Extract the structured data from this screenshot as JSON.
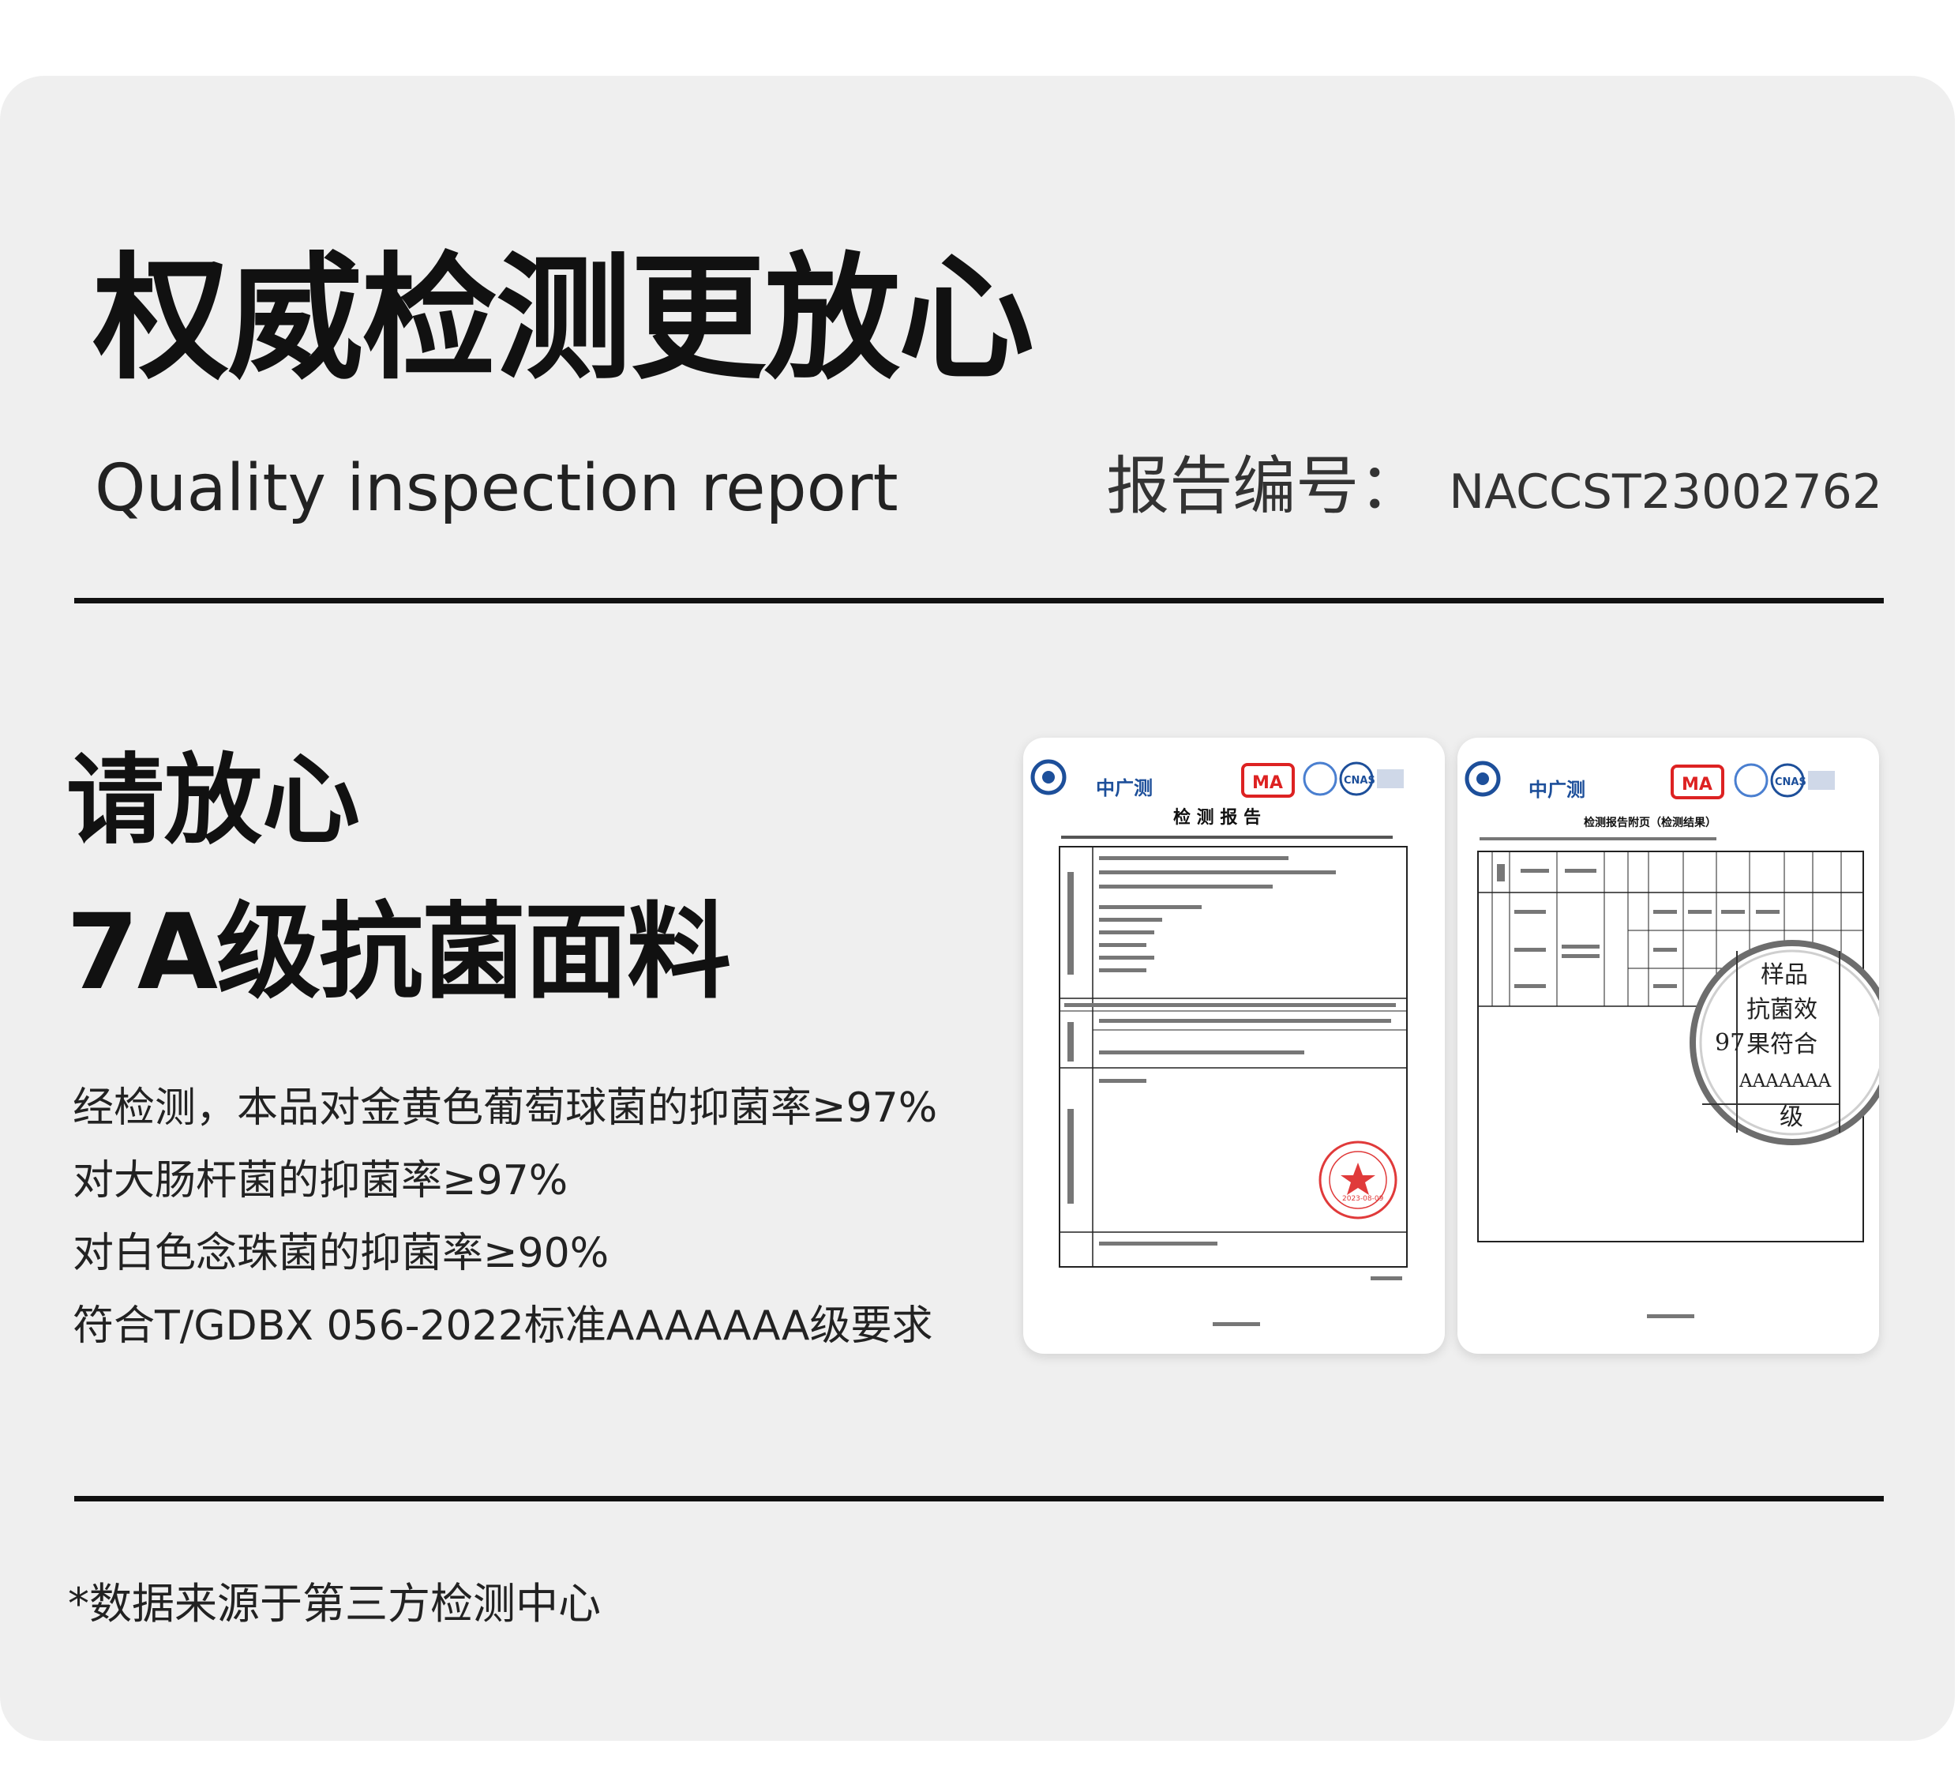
{
  "header": {
    "title": "权威检测更放心",
    "subtitle": "Quality inspection report",
    "report_label": "报告编号：",
    "report_number": "NACCST23002762"
  },
  "main": {
    "heading_line1": "请放心",
    "heading_line2": "7A级抗菌面料",
    "description": [
      "经检测，本品对金黄色葡萄球菌的抑菌率≥97%",
      "对大肠杆菌的抑菌率≥97%",
      "对白色念珠菌的抑菌率≥90%",
      "符合T/GDBX 056-2022标准AAAAAAA级要求"
    ]
  },
  "documents": {
    "report_page": {
      "org_name": "中广测",
      "badges": [
        "MA",
        "CNAS"
      ],
      "title": "检 测 报 告",
      "stamp_text": "2023-08-09"
    },
    "appendix_page": {
      "org_name": "中广测",
      "badges": [
        "MA",
        "CNAS"
      ],
      "title": "检测报告附页（检测结果）",
      "magnifier_value": "97",
      "magnifier_text": [
        "样品",
        "抗菌效",
        "果符合",
        "AAAAAAA",
        "级"
      ]
    }
  },
  "footer": {
    "note": "*数据来源于第三方检测中心"
  }
}
